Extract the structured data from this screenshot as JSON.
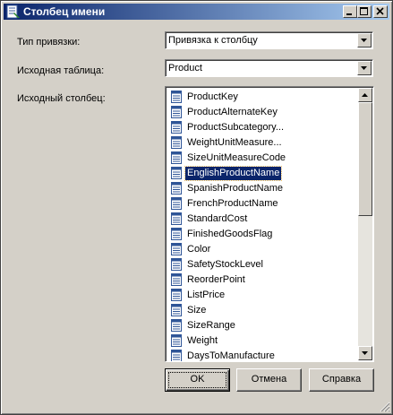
{
  "window": {
    "title": "Столбец имени"
  },
  "form": {
    "binding_type_label": "Тип привязки:",
    "binding_type_value": "Привязка к столбцу",
    "source_table_label": "Исходная таблица:",
    "source_table_value": "Product",
    "source_column_label": "Исходный столбец:"
  },
  "columns": [
    "ProductKey",
    "ProductAlternateKey",
    "ProductSubcategory...",
    "WeightUnitMeasure...",
    "SizeUnitMeasureCode",
    "EnglishProductName",
    "SpanishProductName",
    "FrenchProductName",
    "StandardCost",
    "FinishedGoodsFlag",
    "Color",
    "SafetyStockLevel",
    "ReorderPoint",
    "ListPrice",
    "Size",
    "SizeRange",
    "Weight",
    "DaysToManufacture"
  ],
  "selected_column": "EnglishProductName",
  "buttons": {
    "ok": "OK",
    "cancel": "Отмена",
    "help": "Справка"
  },
  "colors": {
    "titlebar_start": "#0a246a",
    "titlebar_end": "#a6caf0",
    "selection": "#0a246a",
    "face": "#d4d0c8"
  }
}
